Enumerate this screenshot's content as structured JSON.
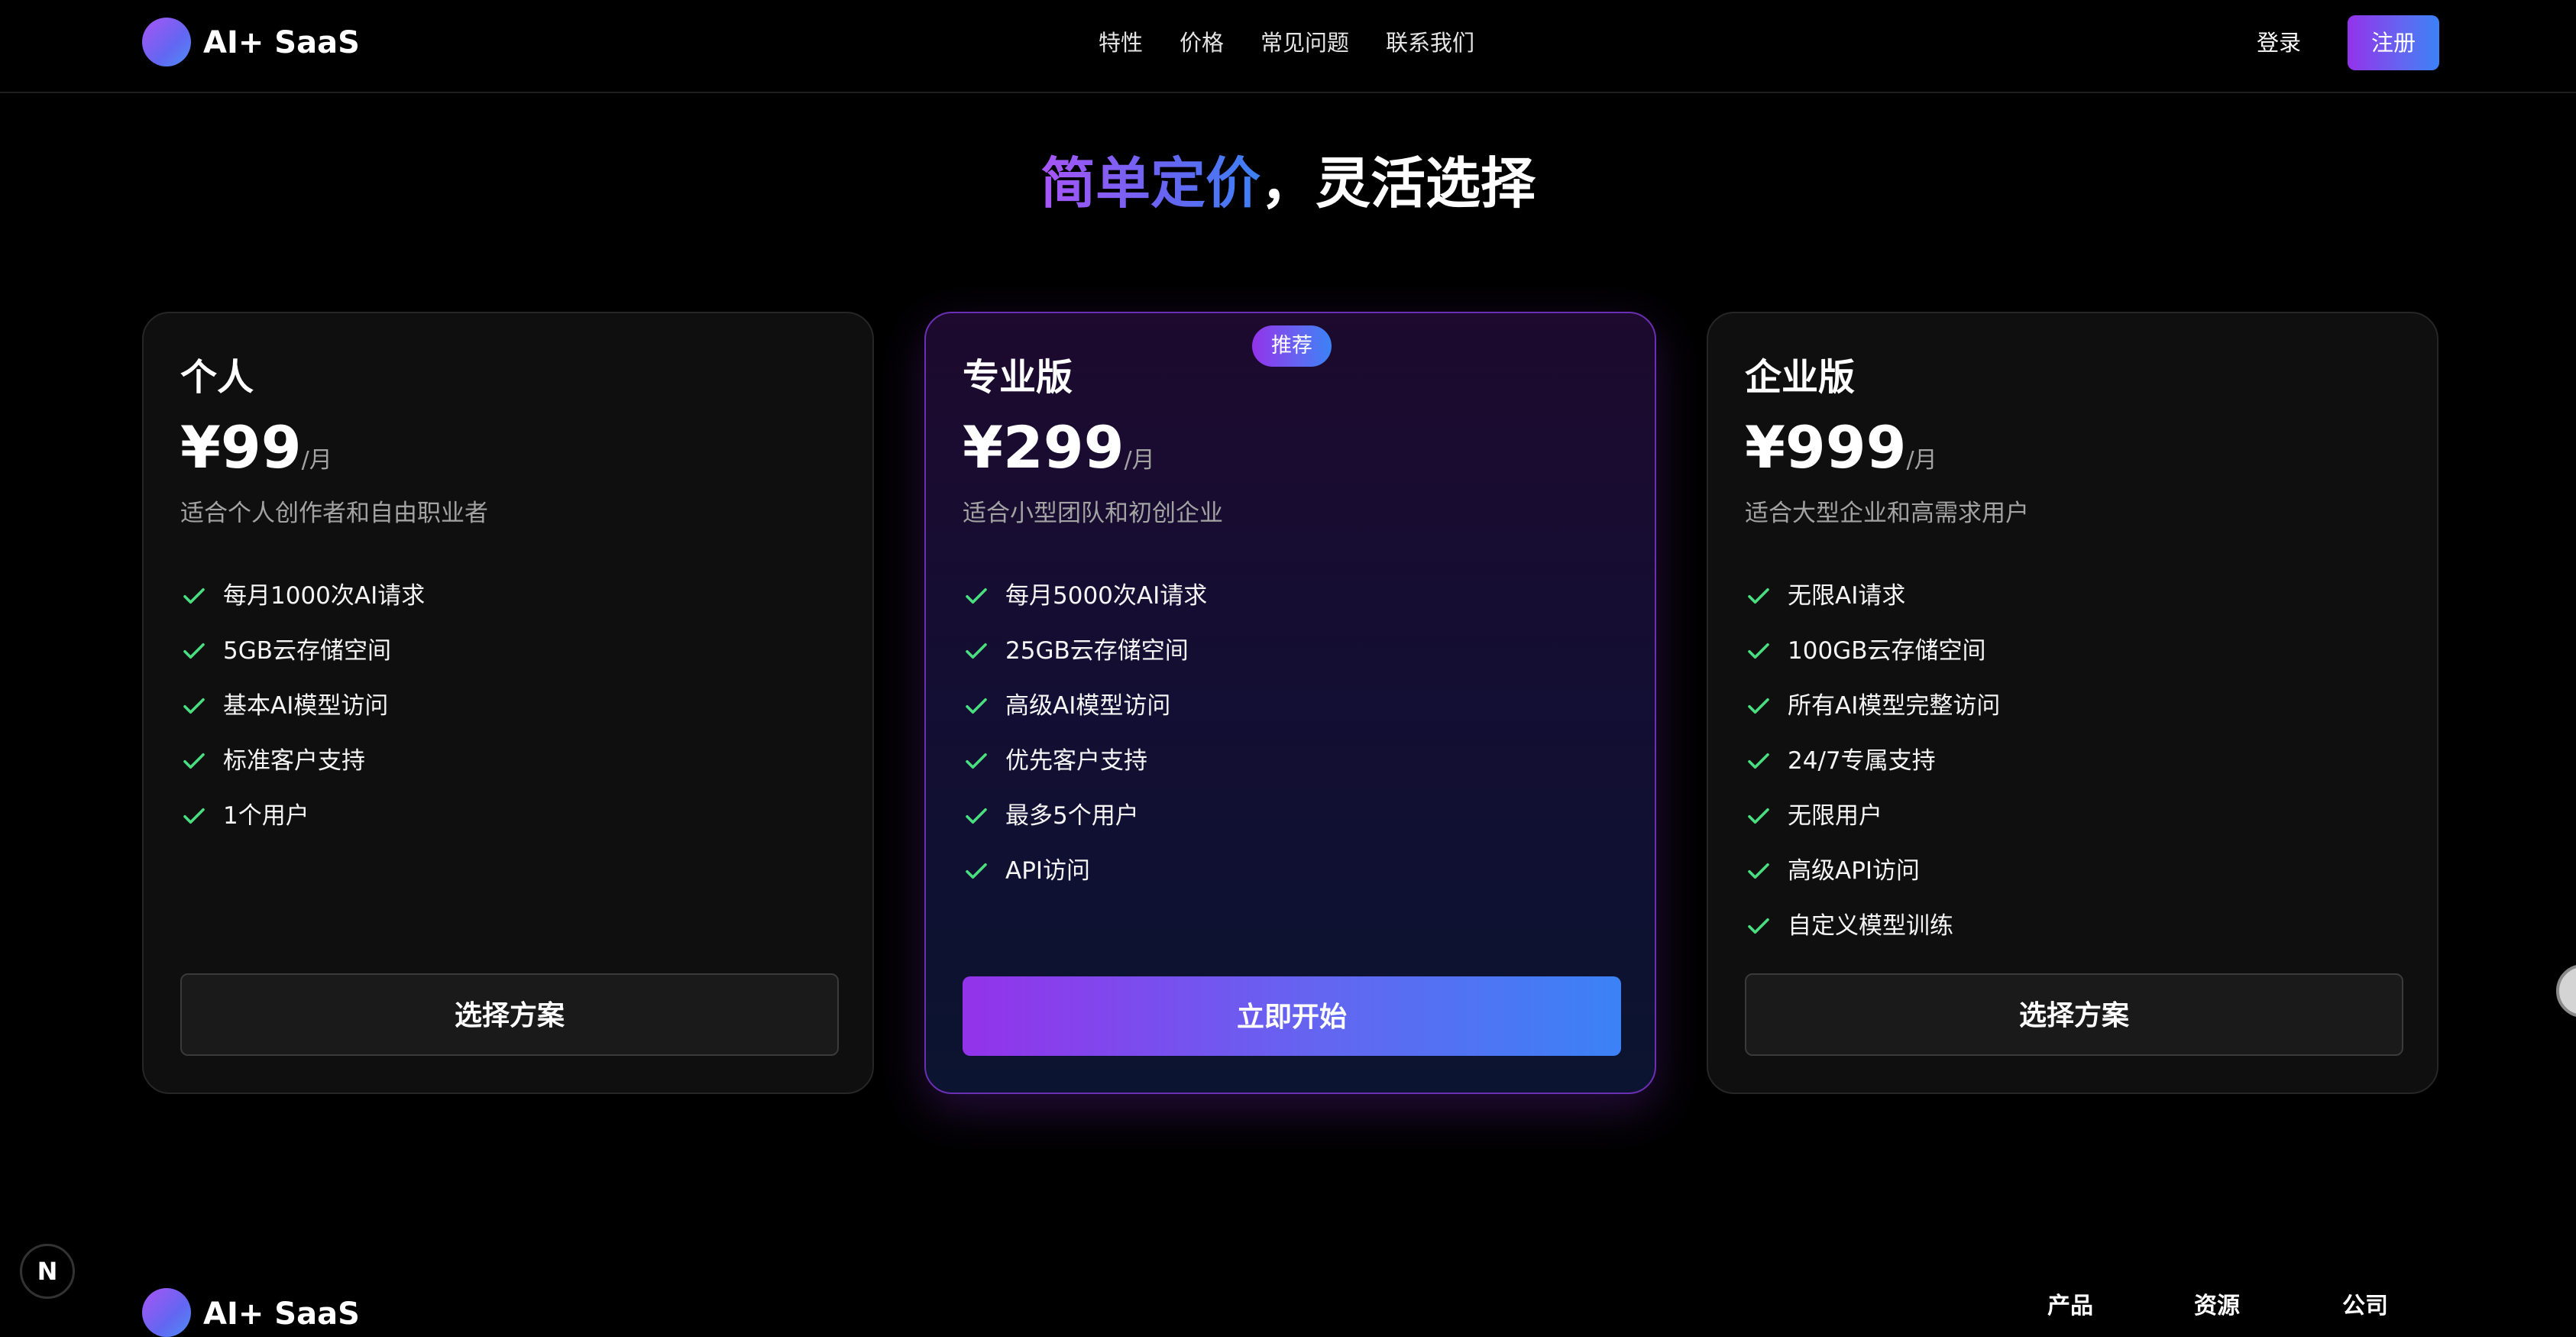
{
  "header": {
    "logo_text": "AI+ SaaS",
    "nav": [
      "特性",
      "价格",
      "常见问题",
      "联系我们"
    ],
    "login_label": "登录",
    "signup_label": "注册"
  },
  "title": {
    "accent": "简单定价",
    "rest": "，灵活选择"
  },
  "plans": [
    {
      "name": "个人",
      "price": "¥99",
      "period": "/月",
      "description": "适合个人创作者和自由职业者",
      "features": [
        "每月1000次AI请求",
        "5GB云存储空间",
        "基本AI模型访问",
        "标准客户支持",
        "1个用户"
      ],
      "button_label": "选择方案"
    },
    {
      "name": "专业版",
      "badge": "推荐",
      "price": "¥299",
      "period": "/月",
      "description": "适合小型团队和初创企业",
      "features": [
        "每月5000次AI请求",
        "25GB云存储空间",
        "高级AI模型访问",
        "优先客户支持",
        "最多5个用户",
        "API访问"
      ],
      "button_label": "立即开始"
    },
    {
      "name": "企业版",
      "price": "¥999",
      "period": "/月",
      "description": "适合大型企业和高需求用户",
      "features": [
        "无限AI请求",
        "100GB云存储空间",
        "所有AI模型完整访问",
        "24/7专属支持",
        "无限用户",
        "高级API访问",
        "自定义模型训练"
      ],
      "button_label": "选择方案"
    }
  ],
  "footer": {
    "logo_text": "AI+ SaaS",
    "columns": [
      "产品",
      "资源",
      "公司"
    ]
  },
  "dev_indicator": "N",
  "colors": {
    "accent_purple": "#9333ea",
    "accent_blue": "#3b82f6",
    "check_green": "#4ade80",
    "background": "#000000"
  },
  "icons": {
    "feature": "check-icon",
    "logo": "gradient-circle-logo"
  }
}
